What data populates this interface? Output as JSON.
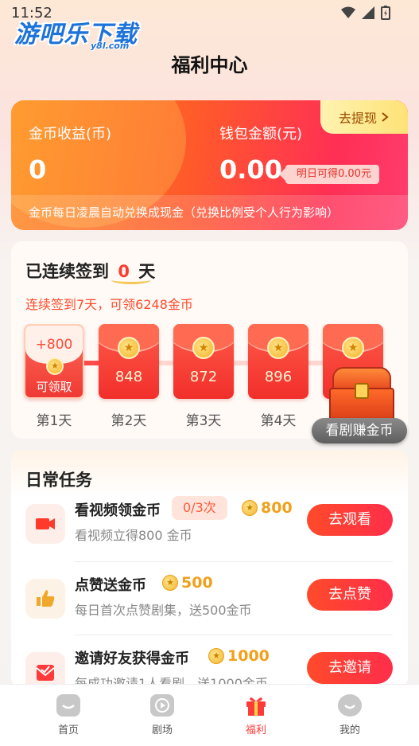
{
  "status_bar": {
    "time": "11:52"
  },
  "watermark": {
    "main": "游吧乐下载",
    "sub": "y8l.com"
  },
  "page": {
    "title": "福利中心"
  },
  "wallet": {
    "coin_label": "金币收益(币)",
    "coin_value": "0",
    "cash_label": "钱包金额(元)",
    "cash_value": "0.00",
    "withdraw_label": "去提现",
    "tomorrow_label": "明日可得0.00元",
    "note": "金币每日凌晨自动兑换成现金（兑换比例受个人行为影响）"
  },
  "signin": {
    "title_prefix": "已连续签到",
    "days_count": "0",
    "title_suffix": "天",
    "subtitle": "连续签到7天，可领6248金币",
    "days": [
      {
        "amount": "+800",
        "status": "可领取",
        "label": "第1天"
      },
      {
        "amount": "848",
        "label": "第2天"
      },
      {
        "amount": "872",
        "label": "第3天"
      },
      {
        "amount": "896",
        "label": "第4天"
      },
      {
        "amount": "",
        "label": ""
      }
    ],
    "chest_button": "看剧赚金币"
  },
  "tasks": {
    "title": "日常任务",
    "items": [
      {
        "name": "看视频领金币",
        "count": "0/3次",
        "reward": "800",
        "desc": "看视频立得800 金币",
        "button": "去观看",
        "icon": "video-camera-icon"
      },
      {
        "name": "点赞送金币",
        "reward": "500",
        "desc": "每日首次点赞剧集，送500金币",
        "button": "去点赞",
        "icon": "thumbs-up-icon"
      },
      {
        "name": "邀请好友获得金币",
        "reward": "1000",
        "desc": "每成功邀请1人看剧，送1000金币",
        "button": "去邀请",
        "icon": "envelope-icon"
      }
    ]
  },
  "tabbar": {
    "items": [
      {
        "label": "首页",
        "icon": "home-icon"
      },
      {
        "label": "剧场",
        "icon": "play-icon"
      },
      {
        "label": "福利",
        "icon": "gift-icon",
        "active": true
      },
      {
        "label": "我的",
        "icon": "profile-icon"
      }
    ]
  },
  "colors": {
    "accent": "#ff3b2f",
    "gold": "#f2a01a",
    "wallet_start": "#ff8a1e",
    "wallet_end": "#ff3d6e"
  }
}
